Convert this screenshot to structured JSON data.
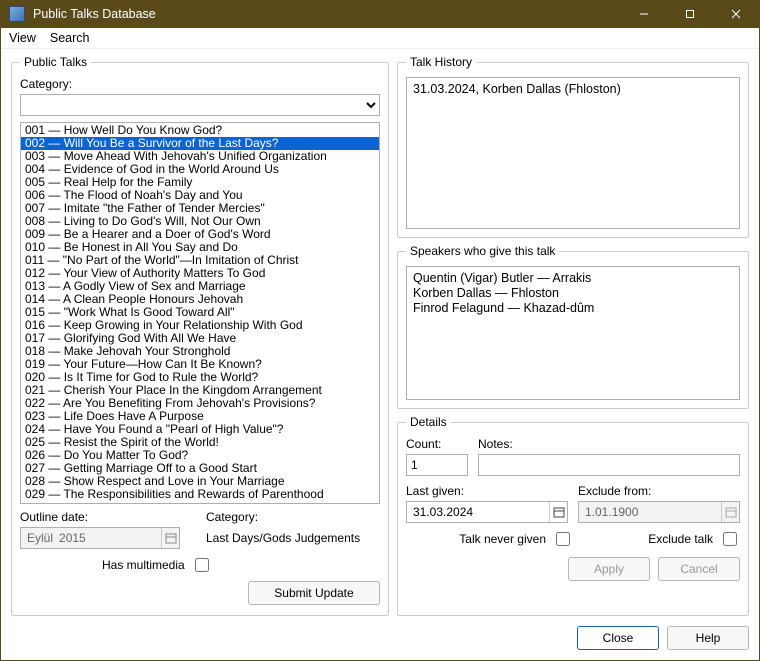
{
  "window": {
    "title": "Public Talks Database"
  },
  "menu": {
    "view": "View",
    "search": "Search"
  },
  "public_talks": {
    "legend": "Public Talks",
    "category_label": "Category:",
    "category_value": "",
    "items": [
      "001 — How Well Do You Know God?",
      "002 — Will You Be a Survivor of the Last Days?",
      "003 — Move Ahead With Jehovah's Unified Organization",
      "004 — Evidence of God in the World Around Us",
      "005 — Real Help for the Family",
      "006 — The Flood of Noah's Day and You",
      "007 — Imitate \"the Father of Tender Mercies\"",
      "008 — Living to Do God's Will, Not Our Own",
      "009 — Be a Hearer and a Doer of God's Word",
      "010 — Be Honest in All You Say and Do",
      "011 — \"No Part of the World\"—In Imitation of Christ",
      "012 — Your View of Authority Matters To God",
      "013 — A Godly View of Sex and Marriage",
      "014 — A Clean People Honours Jehovah",
      "015 — \"Work What Is Good Toward All\"",
      "016 — Keep Growing in Your Relationship With God",
      "017 — Glorifying God With All We Have",
      "018 — Make Jehovah Your Stronghold",
      "019 — Your Future—How Can It Be Known?",
      "020 — Is It Time for God to Rule the World?",
      "021 — Cherish Your Place In the Kingdom Arrangement",
      "022 — Are You Benefiting From Jehovah's Provisions?",
      "023 — Life Does Have A Purpose",
      "024 — Have You Found a \"Pearl of High Value\"?",
      "025 — Resist the Spirit of the World!",
      "026 — Do You Matter To God?",
      "027 — Getting Marriage Off to a Good Start",
      "028 — Show Respect and Love in Your Marriage",
      "029 — The Responsibilities and Rewards of Parenthood"
    ],
    "selected_index": 1,
    "outline_date_label": "Outline date:",
    "outline_month": "Eylül",
    "outline_year": "2015",
    "sub_category_label": "Category:",
    "sub_category_value": "Last Days/Gods Judgements",
    "has_multimedia_label": "Has multimedia",
    "submit_label": "Submit Update"
  },
  "talk_history": {
    "legend": "Talk History",
    "entries": [
      "31.03.2024, Korben Dallas (Fhloston)"
    ]
  },
  "speakers": {
    "legend": "Speakers who give this talk",
    "entries": [
      "Quentin (Vigar) Butler — Arrakis",
      "Korben Dallas — Fhloston",
      "Finrod Felagund — Khazad-dûm"
    ]
  },
  "details": {
    "legend": "Details",
    "count_label": "Count:",
    "count_value": "1",
    "notes_label": "Notes:",
    "notes_value": "",
    "last_given_label": "Last given:",
    "last_given_value": "31.03.2024",
    "exclude_from_label": "Exclude from:",
    "exclude_from_value": "1.01.1900",
    "talk_never_given_label": "Talk never given",
    "exclude_talk_label": "Exclude talk",
    "apply_label": "Apply",
    "cancel_label": "Cancel"
  },
  "footer": {
    "close": "Close",
    "help": "Help"
  }
}
